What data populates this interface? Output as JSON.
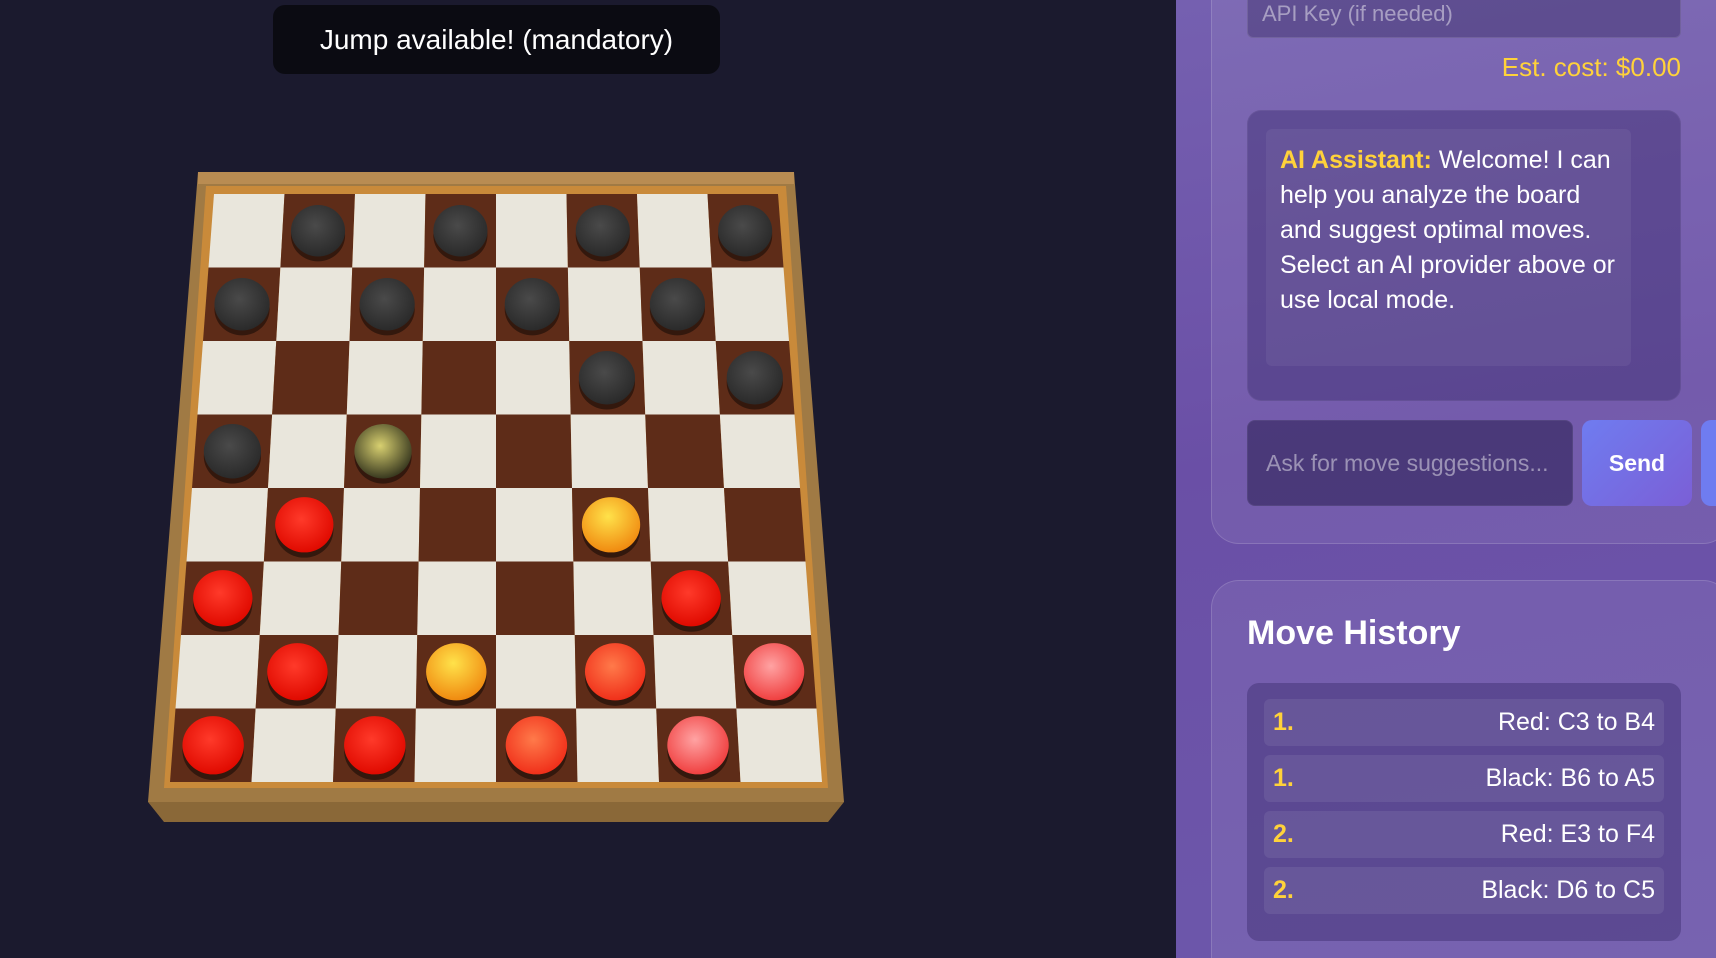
{
  "status": {
    "toast": "Jump available! (mandatory)"
  },
  "colors": {
    "light_square": "#e9e6dc",
    "dark_square": "#5e2c18",
    "frame": "#c98a3a",
    "black_piece": "#3a3a3a",
    "red_piece": "#ff2010",
    "accent_yellow": "#ffd23a"
  },
  "board": {
    "rows": [
      [
        null,
        "black",
        null,
        "black",
        null,
        "black",
        null,
        "black"
      ],
      [
        "black",
        null,
        "black",
        null,
        "black",
        null,
        "black",
        null
      ],
      [
        null,
        null,
        null,
        null,
        null,
        "black",
        null,
        "black"
      ],
      [
        "black",
        null,
        "black-highlight",
        null,
        null,
        null,
        null,
        null
      ],
      [
        null,
        "red",
        null,
        null,
        null,
        "red-highlight",
        null,
        null
      ],
      [
        "red",
        null,
        null,
        null,
        null,
        null,
        "red",
        null
      ],
      [
        null,
        "red",
        null,
        "red-highlight",
        null,
        "red-glow",
        null,
        "red-light"
      ],
      [
        "red",
        null,
        "red",
        null,
        "red-glow",
        null,
        "red-light",
        null
      ]
    ]
  },
  "sidebar": {
    "api_key_placeholder": "API Key (if needed)",
    "est_cost": "Est. cost: $0.00",
    "chat": {
      "sender": "AI Assistant:",
      "message": "Welcome! I can help you analyze the board and suggest optimal moves. Select an AI provider above or use local mode."
    },
    "ask_placeholder": "Ask for move suggestions...",
    "send_label": "Send"
  },
  "history": {
    "title": "Move History",
    "items": [
      {
        "num": "1.",
        "move": "Red: C3 to B4"
      },
      {
        "num": "1.",
        "move": "Black: B6 to A5"
      },
      {
        "num": "2.",
        "move": "Red: E3 to F4"
      },
      {
        "num": "2.",
        "move": "Black: D6 to C5"
      }
    ]
  }
}
